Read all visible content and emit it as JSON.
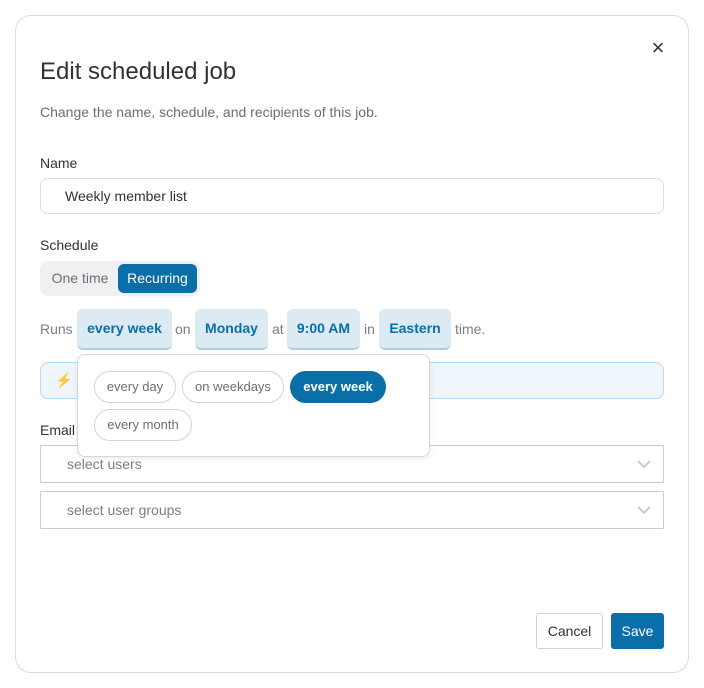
{
  "modal": {
    "close_icon": "×",
    "title": "Edit scheduled job",
    "subtitle": "Change the name, schedule, and recipients of this job."
  },
  "name": {
    "label": "Name",
    "value": "Weekly member list"
  },
  "schedule": {
    "label": "Schedule",
    "options": [
      "One time",
      "Recurring"
    ],
    "selected": "Recurring",
    "sentence": {
      "runs": "Runs",
      "frequency": "every week",
      "on": "on",
      "day": "Monday",
      "at": "at",
      "time": "9:00 AM",
      "in": "in",
      "timezone": "Eastern",
      "suffix": "time."
    },
    "info_icon": "lightning-icon"
  },
  "frequency_dropdown": {
    "options": [
      "every day",
      "on weekdays",
      "every week",
      "every month"
    ],
    "selected": "every week"
  },
  "email": {
    "label": "Email",
    "users_placeholder": "select users",
    "groups_placeholder": "select user groups"
  },
  "footer": {
    "cancel_label": "Cancel",
    "save_label": "Save"
  },
  "colors": {
    "accent": "#0a6ea8",
    "pill_bg": "#dbeaf3",
    "info_bg": "#eef6fc"
  }
}
